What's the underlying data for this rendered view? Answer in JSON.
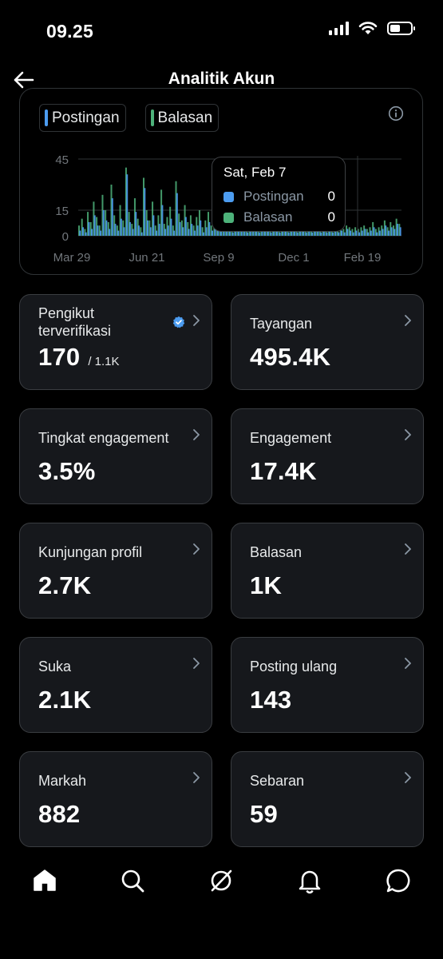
{
  "status_bar": {
    "time": "09.25"
  },
  "header": {
    "title": "Analitik Akun"
  },
  "chart": {
    "legend": [
      {
        "label": "Postingan",
        "color": "#4c9cf0"
      },
      {
        "label": "Balasan",
        "color": "#4db27a"
      }
    ],
    "tooltip": {
      "date": "Sat, Feb 7",
      "rows": [
        {
          "label": "Postingan",
          "value": "0",
          "color": "#4c9cf0"
        },
        {
          "label": "Balasan",
          "value": "0",
          "color": "#4db27a"
        }
      ]
    }
  },
  "chart_data": {
    "type": "bar",
    "title": "",
    "xlabel": "",
    "ylabel": "",
    "ylim": [
      0,
      45
    ],
    "y_ticks": [
      0,
      15,
      45
    ],
    "x_ticks": [
      "Mar 29",
      "Jun 21",
      "Sep 9",
      "Dec 1",
      "Feb 19"
    ],
    "grid": true,
    "legend_position": "top-left",
    "series": [
      {
        "name": "Postingan",
        "color": "#4c9cf0",
        "values": [
          3,
          5,
          2,
          8,
          4,
          12,
          6,
          3,
          15,
          9,
          4,
          22,
          7,
          3,
          10,
          5,
          36,
          8,
          4,
          14,
          6,
          2,
          28,
          9,
          5,
          12,
          3,
          7,
          18,
          4,
          6,
          10,
          3,
          25,
          8,
          5,
          11,
          4,
          7,
          3,
          6,
          9,
          2,
          5,
          8,
          3,
          12,
          4,
          6,
          3,
          5,
          7,
          2,
          4,
          6,
          3,
          5,
          2,
          4,
          3,
          6,
          2,
          4,
          3,
          5,
          2,
          3,
          4,
          2,
          3,
          5,
          2,
          4,
          3,
          2,
          3,
          4,
          2,
          3,
          2,
          4,
          3,
          2,
          3,
          2,
          4,
          2,
          3,
          2,
          3,
          2,
          4,
          3,
          2,
          3,
          2,
          3,
          4,
          2,
          3,
          5,
          2,
          3,
          4,
          6,
          3,
          5,
          4,
          7,
          5
        ]
      },
      {
        "name": "Balasan",
        "color": "#4db27a",
        "values": [
          6,
          10,
          4,
          14,
          8,
          20,
          11,
          6,
          24,
          15,
          8,
          30,
          12,
          6,
          18,
          9,
          40,
          14,
          7,
          22,
          10,
          5,
          34,
          15,
          9,
          20,
          6,
          12,
          27,
          7,
          11,
          17,
          6,
          32,
          13,
          9,
          18,
          8,
          12,
          6,
          11,
          15,
          5,
          9,
          14,
          6,
          19,
          8,
          11,
          6,
          9,
          12,
          5,
          8,
          10,
          6,
          9,
          5,
          8,
          6,
          10,
          4,
          7,
          5,
          9,
          4,
          6,
          7,
          4,
          5,
          8,
          4,
          7,
          5,
          4,
          5,
          7,
          4,
          5,
          4,
          7,
          5,
          4,
          5,
          4,
          6,
          4,
          5,
          4,
          5,
          4,
          6,
          5,
          4,
          5,
          4,
          5,
          6,
          4,
          5,
          8,
          4,
          5,
          6,
          9,
          5,
          8,
          6,
          10,
          7
        ]
      }
    ]
  },
  "cards": [
    {
      "label": "Pengikut terverifikasi",
      "value": "170",
      "sub": "/ 1.1K",
      "verified": true
    },
    {
      "label": "Tayangan",
      "value": "495.4K"
    },
    {
      "label": "Tingkat engagement",
      "value": "3.5%"
    },
    {
      "label": "Engagement",
      "value": "17.4K"
    },
    {
      "label": "Kunjungan profil",
      "value": "2.7K"
    },
    {
      "label": "Balasan",
      "value": "1K"
    },
    {
      "label": "Suka",
      "value": "2.1K"
    },
    {
      "label": "Posting ulang",
      "value": "143"
    },
    {
      "label": "Markah",
      "value": "882"
    },
    {
      "label": "Sebaran",
      "value": "59"
    }
  ],
  "bottom_nav": [
    {
      "icon": "home-icon"
    },
    {
      "icon": "search-icon"
    },
    {
      "icon": "grok-icon"
    },
    {
      "icon": "bell-icon"
    },
    {
      "icon": "messages-icon"
    }
  ]
}
